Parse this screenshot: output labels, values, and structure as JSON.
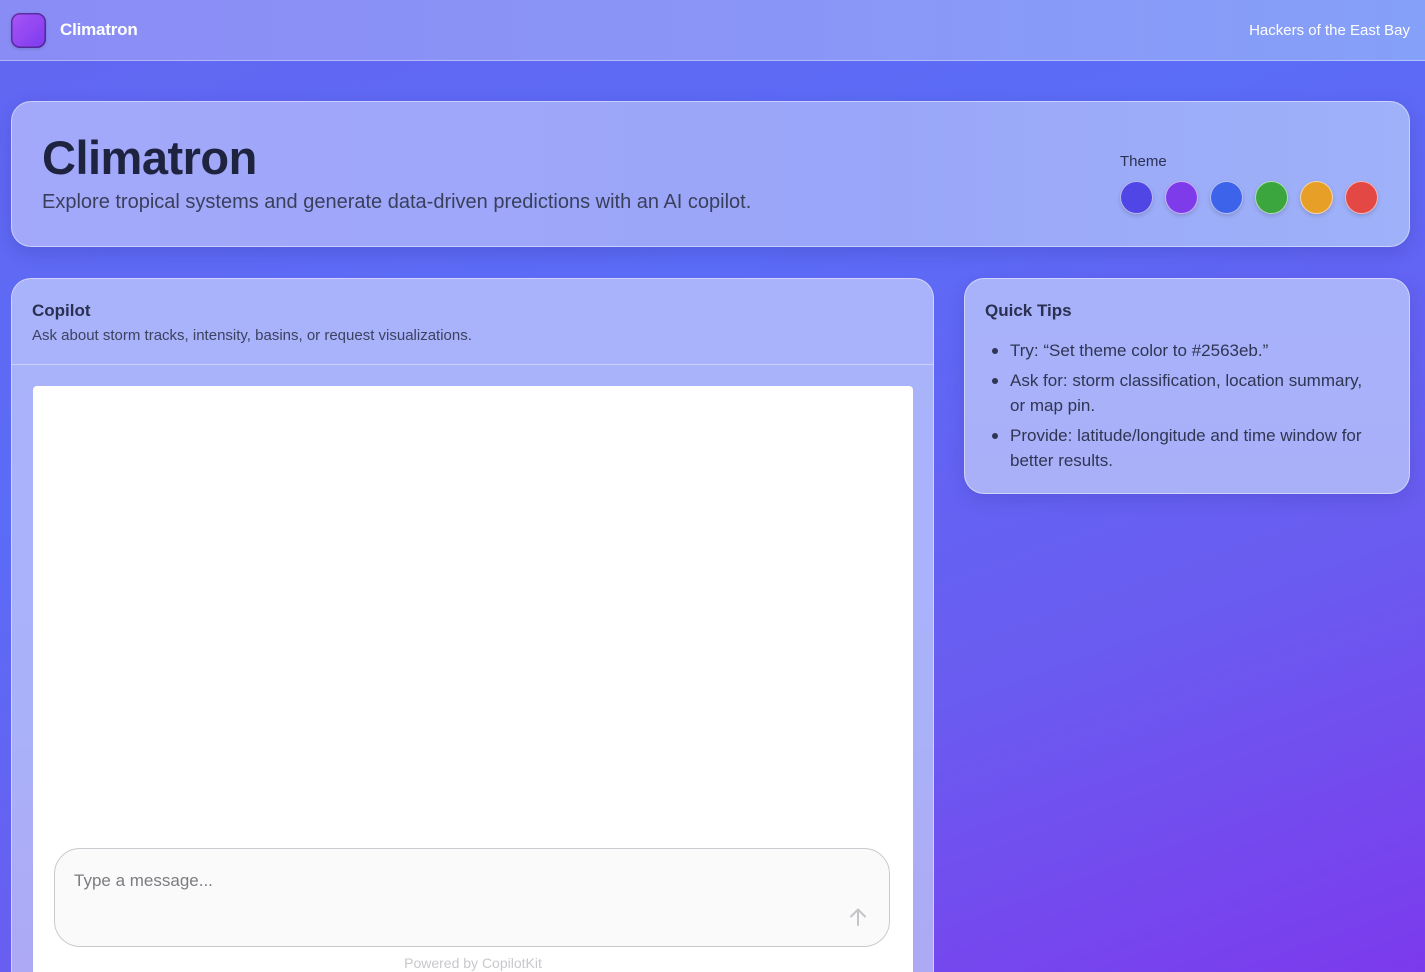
{
  "topbar": {
    "brand_name": "Climatron",
    "org_link": "Hackers of the East Bay"
  },
  "hero": {
    "title": "Climatron",
    "subtitle": "Explore tropical systems and generate data-driven predictions with an AI copilot.",
    "theme_label": "Theme",
    "theme_colors": [
      {
        "name": "indigo",
        "hex": "#4f46e5"
      },
      {
        "name": "purple",
        "hex": "#7e3bea"
      },
      {
        "name": "blue",
        "hex": "#3e63eb"
      },
      {
        "name": "green",
        "hex": "#3ba53e"
      },
      {
        "name": "amber",
        "hex": "#e89f28"
      },
      {
        "name": "red",
        "hex": "#e34845"
      }
    ]
  },
  "copilot": {
    "title": "Copilot",
    "subtitle": "Ask about storm tracks, intensity, basins, or request visualizations.",
    "input_placeholder": "Type a message...",
    "send_icon": "arrow-up-icon",
    "powered_by": "Powered by CopilotKit"
  },
  "tips": {
    "title": "Quick Tips",
    "items": [
      "Try: “Set theme color to #2563eb.”",
      "Ask for: storm classification, location summary, or map pin.",
      "Provide: latitude/longitude and time window for better results."
    ]
  }
}
